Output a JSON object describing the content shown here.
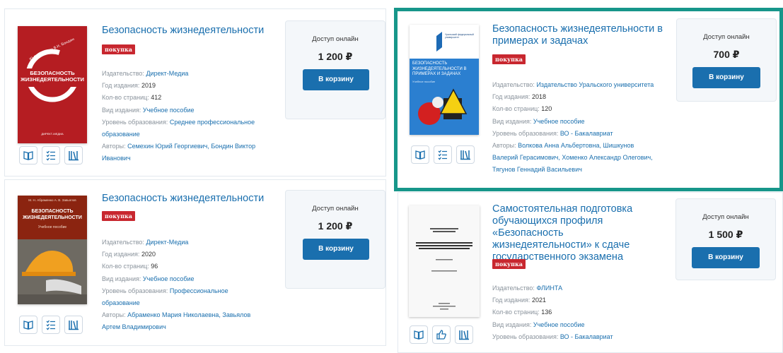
{
  "colors": {
    "accent": "#1a6fae",
    "badge": "#c8272f",
    "highlight": "#17968a"
  },
  "cards": [
    {
      "title": "Безопасность жизнедеятельности",
      "badge": "покупка",
      "access_label": "Доступ онлайн",
      "price": "1 200 ₽",
      "cart_label": "В корзину",
      "cover": {
        "authors": "Ю. Г. Семехин  В. Н. Бондин",
        "title": "БЕЗОПАСНОСТЬ ЖИЗНЕДЕЯТЕЛЬНОСТИ",
        "publisher": "ДИРЕКТ-МЕДИА"
      },
      "publisher_label": "Издательство:",
      "publisher": "Директ-Медиа",
      "year_label": "Год издания:",
      "year": "2019",
      "pages_label": "Кол-во страниц:",
      "pages": "412",
      "type_label": "Вид издания:",
      "type": "Учебное пособие",
      "level_label": "Уровень образования:",
      "level_line1": "Среднее профессиональное",
      "level_line2": "образование",
      "authors_label": "Авторы:",
      "authors_line1": "Семехин Юрий Георгиевич, Бондин Виктор",
      "authors_line2": "Иванович"
    },
    {
      "title": "Безопасность жизнедеятельности",
      "badge": "покупка",
      "access_label": "Доступ онлайн",
      "price": "1 200 ₽",
      "cart_label": "В корзину",
      "cover": {
        "authors": "М. Н. Абраменко  А. В. Завьялов",
        "title": "БЕЗОПАСНОСТЬ ЖИЗНЕДЕЯТЕЛЬНОСТИ",
        "subtitle": "Учебное пособие"
      },
      "publisher_label": "Издательство:",
      "publisher": "Директ-Медиа",
      "year_label": "Год издания:",
      "year": "2020",
      "pages_label": "Кол-во страниц:",
      "pages": "96",
      "type_label": "Вид издания:",
      "type": "Учебное пособие",
      "level_label": "Уровень образования:",
      "level_line1": "Профессиональное",
      "level_line2": "образование",
      "authors_label": "Авторы:",
      "authors_line1": "Абраменко Мария Николаевна, Завьялов",
      "authors_line2": "Артем Владимирович"
    },
    {
      "title_line1": "Безопасность жизнедеятельности в",
      "title_line2": "примерах и задачах",
      "badge": "покупка",
      "access_label": "Доступ онлайн",
      "price": "700 ₽",
      "cart_label": "В корзину",
      "cover": {
        "title": "БЕЗОПАСНОСТЬ ЖИЗНЕДЕЯТЕЛЬНОСТИ В ПРИМЕРАХ И ЗАДАЧАХ",
        "subtitle": "Учебное пособие",
        "publisher": "Уральский федеральный университет"
      },
      "publisher_label": "Издательство:",
      "publisher": "Издательство Уральского университета",
      "year_label": "Год издания:",
      "year": "2018",
      "pages_label": "Кол-во страниц:",
      "pages": "120",
      "type_label": "Вид издания:",
      "type": "Учебное пособие",
      "level_label": "Уровень образования:",
      "level": "ВО - Бакалавриат",
      "authors_label": "Авторы:",
      "authors_line1": "Волкова Анна Альбертовна, Шишкунов",
      "authors_line2": "Валерий Герасимович, Хоменко Александр Олегович,",
      "authors_line3": "Тягунов Геннадий Васильевич"
    },
    {
      "title_line1": "Самостоятельная подготовка",
      "title_line2": "обучающихся профиля «Безопасность",
      "title_line3": "жизнедеятельности» к сдаче",
      "title_line4": "государственного экзамена",
      "badge": "покупка",
      "access_label": "Доступ онлайн",
      "price": "1 500 ₽",
      "cart_label": "В корзину",
      "publisher_label": "Издательство:",
      "publisher": "ФЛИНТА",
      "year_label": "Год издания:",
      "year": "2021",
      "pages_label": "Кол-во страниц:",
      "pages": "136",
      "type_label": "Вид издания:",
      "type": "Учебное пособие",
      "level_label": "Уровень образования:",
      "level": "ВО - Бакалавриат"
    }
  ],
  "icons": [
    "open-book-icon",
    "checklist-icon",
    "library-icon",
    "thumbs-up-icon"
  ]
}
